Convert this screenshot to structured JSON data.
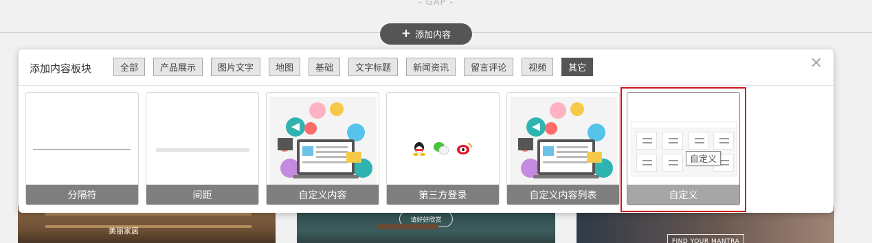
{
  "page": {
    "gap_label": "- GAP -",
    "add_content_button": "添加内容"
  },
  "dialog": {
    "title": "添加内容板块",
    "tabs": [
      {
        "label": "全部",
        "active": false
      },
      {
        "label": "产品展示",
        "active": false
      },
      {
        "label": "图片文字",
        "active": false
      },
      {
        "label": "地图",
        "active": false
      },
      {
        "label": "基础",
        "active": false
      },
      {
        "label": "文字标题",
        "active": false
      },
      {
        "label": "新闻资讯",
        "active": false
      },
      {
        "label": "留言评论",
        "active": false
      },
      {
        "label": "视频",
        "active": false
      },
      {
        "label": "其它",
        "active": true
      }
    ],
    "cards": [
      {
        "label": "分隔符",
        "icon": "divider-line-icon"
      },
      {
        "label": "间距",
        "icon": "spacer-bar-icon"
      },
      {
        "label": "自定义内容",
        "icon": "laptop-illustration-icon"
      },
      {
        "label": "第三方登录",
        "icon": "social-login-icon"
      },
      {
        "label": "自定义内容列表",
        "icon": "laptop-illustration-icon"
      },
      {
        "label": "自定义",
        "icon": "layout-grid-icon",
        "selected": true
      }
    ],
    "tooltip": "自定义",
    "close_icon": "close-icon"
  },
  "background": {
    "banner_1_text": "美丽家居",
    "banner_2_button": "请好好欣赏",
    "banner_3_button": "FIND YOUR MANTRA"
  },
  "colors": {
    "active_tab": "#555555",
    "card_label": "#7f7f7f",
    "selection_outline": "#d0161b"
  }
}
